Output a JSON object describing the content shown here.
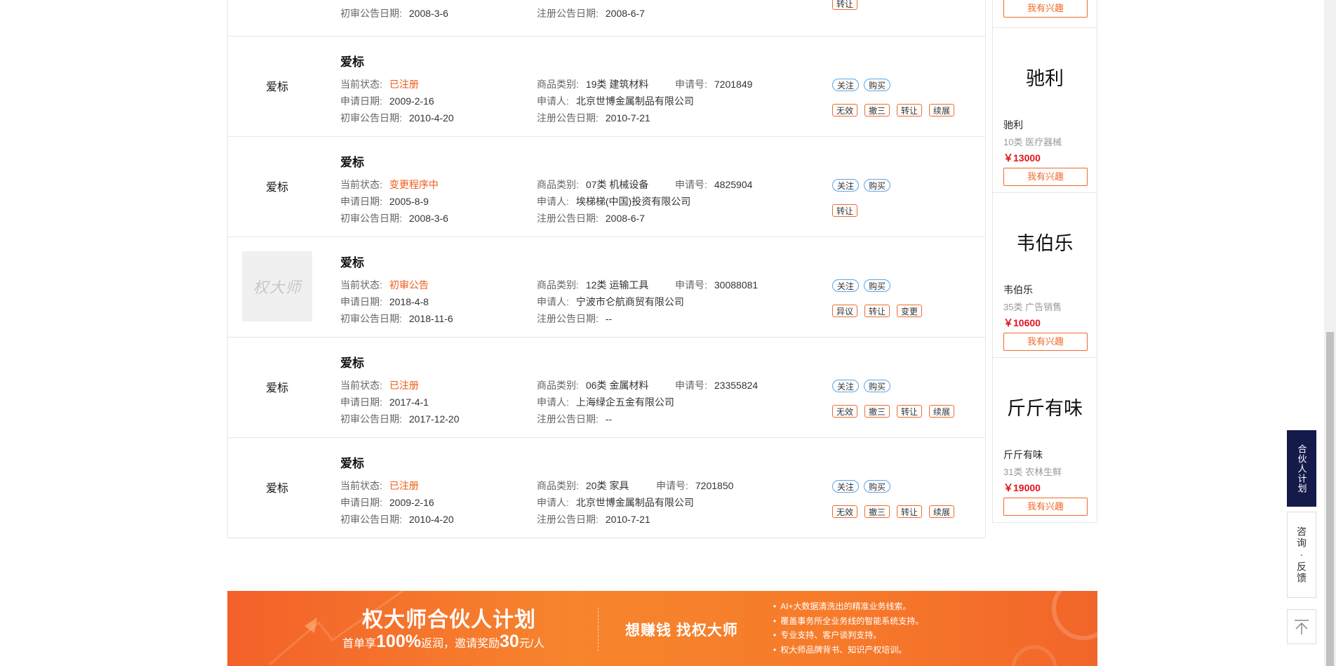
{
  "labels": {
    "status": "当前状态:",
    "apply_date": "申请日期:",
    "prelim_date": "初审公告日期:",
    "category": "商品类别:",
    "apply_no": "申请号:",
    "applicant": "申请人:",
    "reg_date": "注册公告日期:"
  },
  "partial_row": {
    "prelim_date": "2008-3-6",
    "reg_date": "2008-6-7",
    "action": "转让"
  },
  "results": [
    {
      "name": "爱标",
      "status": "已注册",
      "apply_date": "2009-2-16",
      "prelim_date": "2010-4-20",
      "category": "19类 建筑材料",
      "apply_no": "7201849",
      "applicant": "北京世博金属制品有限公司",
      "reg_date": "2010-7-21",
      "logo_icon": "aibiao-bubble-logo",
      "actions_primary": [
        "关注",
        "购买"
      ],
      "actions_secondary": [
        "无效",
        "撤三",
        "转让",
        "续展"
      ]
    },
    {
      "name": "爱标",
      "status": "变更程序中",
      "apply_date": "2005-8-9",
      "prelim_date": "2008-3-6",
      "category": "07类 机械设备",
      "apply_no": "4825904",
      "applicant": "埃梯梯(中国)投资有限公司",
      "reg_date": "2008-6-7",
      "logo_icon": "aibiao-serif-logo",
      "actions_primary": [
        "关注",
        "购买"
      ],
      "actions_secondary": [
        "转让"
      ]
    },
    {
      "name": "爱标",
      "status": "初审公告",
      "apply_date": "2018-4-8",
      "prelim_date": "2018-11-6",
      "category": "12类 运输工具",
      "apply_no": "30088081",
      "applicant": "宁波市仑航商贸有限公司",
      "reg_date": "--",
      "logo_icon": "quandashi-placeholder-logo",
      "actions_primary": [
        "关注",
        "购买"
      ],
      "actions_secondary": [
        "异议",
        "转让",
        "变更"
      ]
    },
    {
      "name": "爱标",
      "status": "已注册",
      "apply_date": "2017-4-1",
      "prelim_date": "2017-12-20",
      "category": "06类 金属材料",
      "apply_no": "23355824",
      "applicant": "上海绿企五金有限公司",
      "reg_date": "--",
      "logo_icon": "aibiao-calligraphy-logo",
      "actions_primary": [
        "关注",
        "购买"
      ],
      "actions_secondary": [
        "无效",
        "撤三",
        "转让",
        "续展"
      ]
    },
    {
      "name": "爱标",
      "status": "已注册",
      "apply_date": "2009-2-16",
      "prelim_date": "2010-4-20",
      "category": "20类 家具",
      "apply_no": "7201850",
      "applicant": "北京世博金属制品有限公司",
      "reg_date": "2010-7-21",
      "logo_icon": "aibiao-bubble-logo",
      "actions_primary": [
        "关注",
        "购买"
      ],
      "actions_secondary": [
        "无效",
        "撤三",
        "转让",
        "续展"
      ]
    }
  ],
  "placeholder_logo_text": "权大师",
  "sidebar": {
    "interest_label": "我有兴趣",
    "cards": [
      {
        "logo": "驰利",
        "name": "驰利",
        "category": "10类 医疗器械",
        "price": "￥13000"
      },
      {
        "logo": "韦伯乐",
        "name": "韦伯乐",
        "category": "35类 广告销售",
        "price": "￥10600"
      },
      {
        "logo": "斤斤有味",
        "name": "斤斤有味",
        "category": "31类 农林生鲜",
        "price": "￥19000"
      }
    ]
  },
  "float": {
    "partner": "合伙人计划",
    "feedback": "咨询·反馈",
    "top_icon": "arrow-up-to-top-icon"
  },
  "banner": {
    "title": "权大师合伙人计划",
    "sub_pre": "首单享",
    "sub_pct": "100%",
    "sub_mid": "返润，邀请奖励",
    "sub_amt": "30",
    "sub_unit": "元/人",
    "slogan": "想赚钱  找权大师",
    "points": [
      "AI+大数据清洗出的精准业务线索。",
      "覆盖事务所全业务线的智能系统支持。",
      "专业支持、客户谈判支持。",
      "权大师品牌背书、知识产权培训。"
    ]
  },
  "colors": {
    "accent": "#f05a12",
    "price": "#e0141e",
    "partner_bg": "#141a4a",
    "tag_blue": "#5aa5e8"
  }
}
